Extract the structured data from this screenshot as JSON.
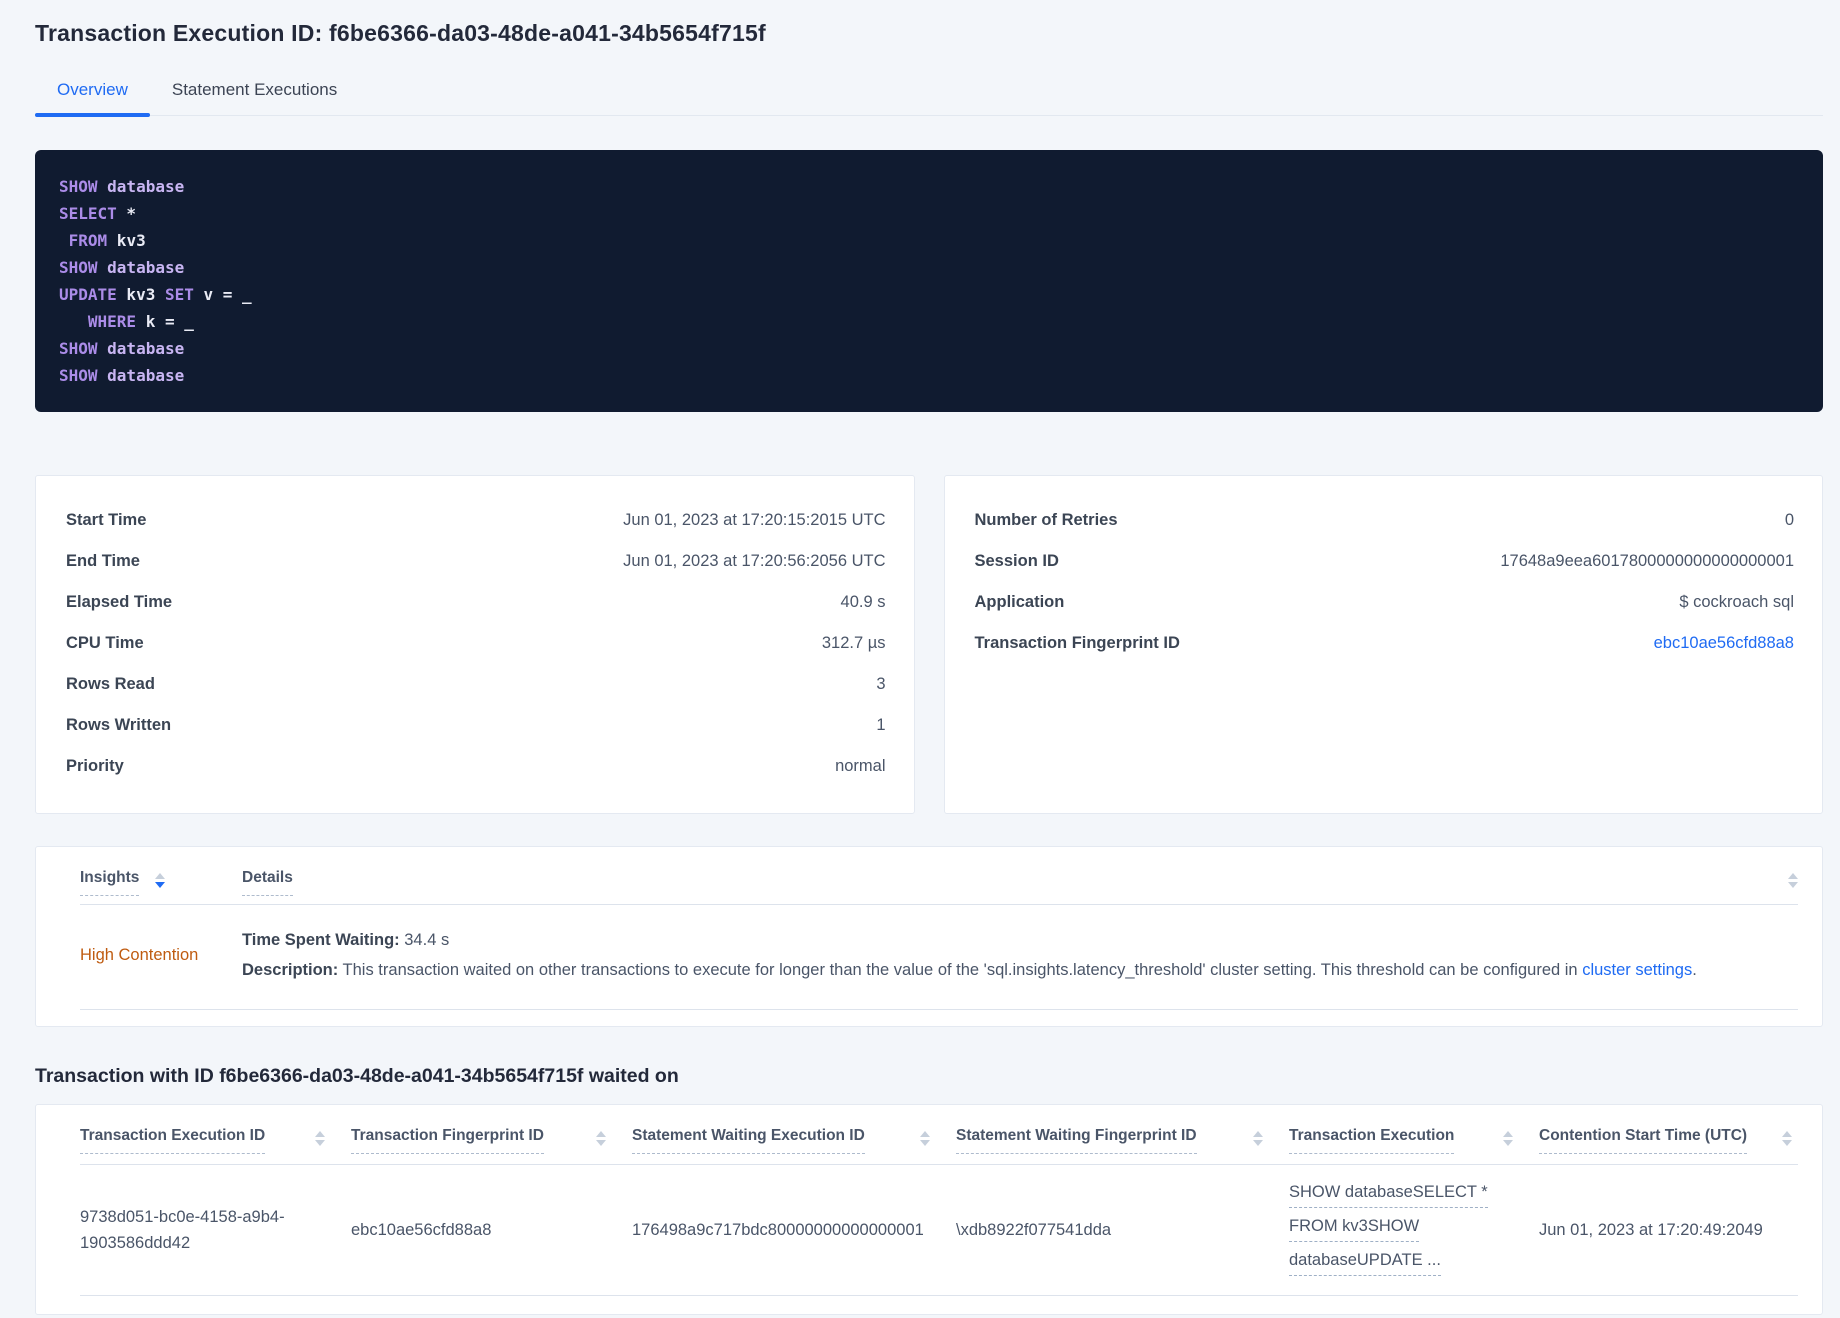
{
  "page": {
    "title": "Transaction Execution ID: f6be6366-da03-48de-a041-34b5654f715f"
  },
  "tabs": {
    "overview": "Overview",
    "statement_executions": "Statement Executions"
  },
  "colors": {
    "accent_blue": "#1f6bf3",
    "warning_orange": "#bf5b10",
    "code_background": "#101b30",
    "code_keyword": "#ab8ce8",
    "code_keyword_secondary": "#c8b5f2",
    "code_plain": "#e9ebf5"
  },
  "code": {
    "lines": [
      {
        "parts": [
          {
            "t": "SHOW",
            "c": "kw"
          },
          {
            "t": " database",
            "c": "kw2"
          }
        ]
      },
      {
        "parts": [
          {
            "t": "SELECT",
            "c": "kw"
          },
          {
            "t": " *",
            "c": "pl"
          }
        ]
      },
      {
        "parts": [
          {
            "t": " FROM",
            "c": "kw"
          },
          {
            "t": " kv3",
            "c": "pl"
          }
        ]
      },
      {
        "parts": [
          {
            "t": "SHOW",
            "c": "kw"
          },
          {
            "t": " database",
            "c": "kw2"
          }
        ]
      },
      {
        "parts": [
          {
            "t": "UPDATE",
            "c": "kw"
          },
          {
            "t": " kv3 ",
            "c": "pl"
          },
          {
            "t": "SET",
            "c": "kw"
          },
          {
            "t": " v = _",
            "c": "pl"
          }
        ]
      },
      {
        "parts": [
          {
            "t": "   WHERE",
            "c": "kw"
          },
          {
            "t": " k = _",
            "c": "pl"
          }
        ]
      },
      {
        "parts": [
          {
            "t": "SHOW",
            "c": "kw"
          },
          {
            "t": " database",
            "c": "kw2"
          }
        ]
      },
      {
        "parts": [
          {
            "t": "SHOW",
            "c": "kw"
          },
          {
            "t": " database",
            "c": "kw2"
          }
        ]
      }
    ]
  },
  "summary_left": {
    "rows": [
      {
        "label": "Start Time",
        "value": "Jun 01, 2023 at 17:20:15:2015 UTC"
      },
      {
        "label": "End Time",
        "value": "Jun 01, 2023 at 17:20:56:2056 UTC"
      },
      {
        "label": "Elapsed Time",
        "value": "40.9 s"
      },
      {
        "label": "CPU Time",
        "value": "312.7 µs"
      },
      {
        "label": "Rows Read",
        "value": "3"
      },
      {
        "label": "Rows Written",
        "value": "1"
      },
      {
        "label": "Priority",
        "value": "normal"
      }
    ]
  },
  "summary_right": {
    "rows": [
      {
        "label": "Number of Retries",
        "value": "0"
      },
      {
        "label": "Session ID",
        "value": "17648a9eea6017800000000000000001"
      },
      {
        "label": "Application",
        "value": "$ cockroach sql"
      },
      {
        "label": "Transaction Fingerprint ID",
        "value": "ebc10ae56cfd88a8"
      }
    ]
  },
  "insights": {
    "header": {
      "insights": "Insights",
      "details": "Details"
    },
    "row": {
      "insight": "High Contention",
      "waiting_label": "Time Spent Waiting:",
      "waiting_value": " 34.4 s",
      "description_label": "Description:",
      "description_text": " This transaction waited on other transactions to execute for longer than the value of the 'sql.insights.latency_threshold' cluster setting. This threshold can be configured in ",
      "description_link": "cluster settings",
      "description_suffix": "."
    }
  },
  "waited_on": {
    "heading": "Transaction with ID f6be6366-da03-48de-a041-34b5654f715f waited on",
    "columns": [
      "Transaction Execution ID",
      "Transaction Fingerprint ID",
      "Statement Waiting Execution ID",
      "Statement Waiting Fingerprint ID",
      "Transaction Execution",
      "Contention Start Time (UTC)"
    ],
    "row": {
      "transaction_execution_id": "9738d051-bc0e-4158-a9b4-1903586ddd42",
      "transaction_fingerprint_id": "ebc10ae56cfd88a8",
      "statement_waiting_execution_id": "176498a9c717bdc80000000000000001",
      "statement_waiting_fingerprint_id": "\\xdb8922f077541dda",
      "transaction_execution_lines": [
        "SHOW databaseSELECT *",
        "FROM kv3SHOW",
        "databaseUPDATE ..."
      ],
      "contention_start_time": "Jun 01, 2023 at 17:20:49:2049"
    }
  }
}
